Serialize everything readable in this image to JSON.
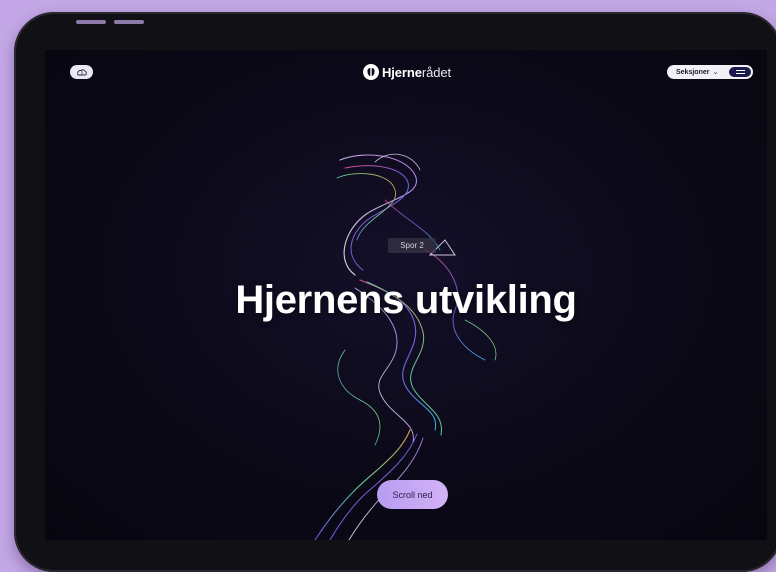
{
  "brand": {
    "name_bold": "Hjerne",
    "name_light": "rådet"
  },
  "nav": {
    "sections_label": "Seksjoner",
    "chevron": "⌄"
  },
  "hero": {
    "tag": "Spor 2",
    "title": "Hjernens utvikling",
    "cta": "Scroll ned"
  },
  "icons": {
    "left": "brain-icon",
    "logo": "brain-logo-icon",
    "menu": "hamburger-menu-icon"
  },
  "colors": {
    "frame": "#c3a7e6",
    "screen": "#0b0917",
    "cta": "#c4a6f3",
    "menu": "#1b1750"
  }
}
